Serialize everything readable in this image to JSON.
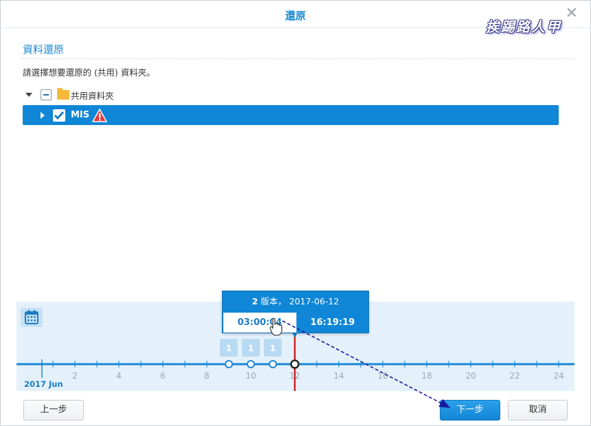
{
  "window": {
    "title": "還原",
    "watermark": "挨踢路人甲"
  },
  "section": {
    "title": "資料還原",
    "description": "請選擇想要還原的 (共用) 資料夾。"
  },
  "tree": {
    "root_label": "共用資料夾",
    "child_label": "MIS"
  },
  "timeline": {
    "popup": {
      "version_count": "2",
      "version_text": "版本，",
      "date": "2017-06-12",
      "times": [
        "03:00:04",
        "16:19:19"
      ]
    },
    "month_label": "2017 Jun",
    "ticks": [
      "2",
      "4",
      "6",
      "8",
      "10",
      "12",
      "14",
      "16",
      "18",
      "20",
      "22",
      "24"
    ],
    "snapshots": [
      {
        "day": 9,
        "count": "1"
      },
      {
        "day": 10,
        "count": "1"
      },
      {
        "day": 11,
        "count": "1"
      },
      {
        "day": 12,
        "count": ""
      }
    ],
    "selected_day": 12,
    "accent_color": "#1a86d4",
    "marker_color": "#d42020"
  },
  "footer": {
    "prev_label": "上一步",
    "next_label": "下一步",
    "cancel_label": "取消"
  }
}
